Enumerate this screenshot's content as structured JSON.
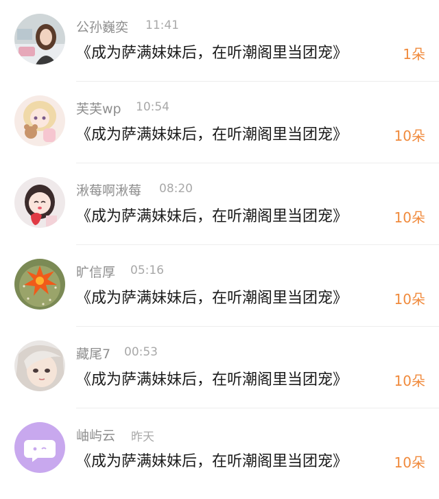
{
  "items": [
    {
      "user": "公孙巍奕",
      "time": "11:41",
      "title": "《成为萨满妹妹后，在听潮阁里当团宠》",
      "count": "1朵",
      "avatar_icon": "photo-avatar-girl-icon"
    },
    {
      "user": "芙芙wp",
      "time": "10:54",
      "title": "《成为萨满妹妹后，在听潮阁里当团宠》",
      "count": "10朵",
      "avatar_icon": "anime-girl-teddy-bear-icon"
    },
    {
      "user": "湫莓啊湫莓",
      "time": "08:20",
      "title": "《成为萨满妹妹后，在听潮阁里当团宠》",
      "count": "10朵",
      "avatar_icon": "cartoon-girl-strawberry-icon"
    },
    {
      "user": "旷信厚",
      "time": "05:16",
      "title": "《成为萨满妹妹后，在听潮阁里当团宠》",
      "count": "10朵",
      "avatar_icon": "cactus-flower-icon"
    },
    {
      "user": "藏尾7",
      "time": "00:53",
      "title": "《成为萨满妹妹后，在听潮阁里当团宠》",
      "count": "10朵",
      "avatar_icon": "anime-face-icon"
    },
    {
      "user": "岫屿云",
      "time": "昨天",
      "title": "《成为萨满妹妹后，在听潮阁里当团宠》",
      "count": "10朵",
      "avatar_icon": "chat-bubble-icon"
    }
  ],
  "colors": {
    "count": "#f08a3c",
    "name": "#8e8e8e",
    "time": "#a8a8a8",
    "title": "#1a1a1a",
    "divider": "#ededed",
    "default_avatar": "#c8a8ee"
  }
}
